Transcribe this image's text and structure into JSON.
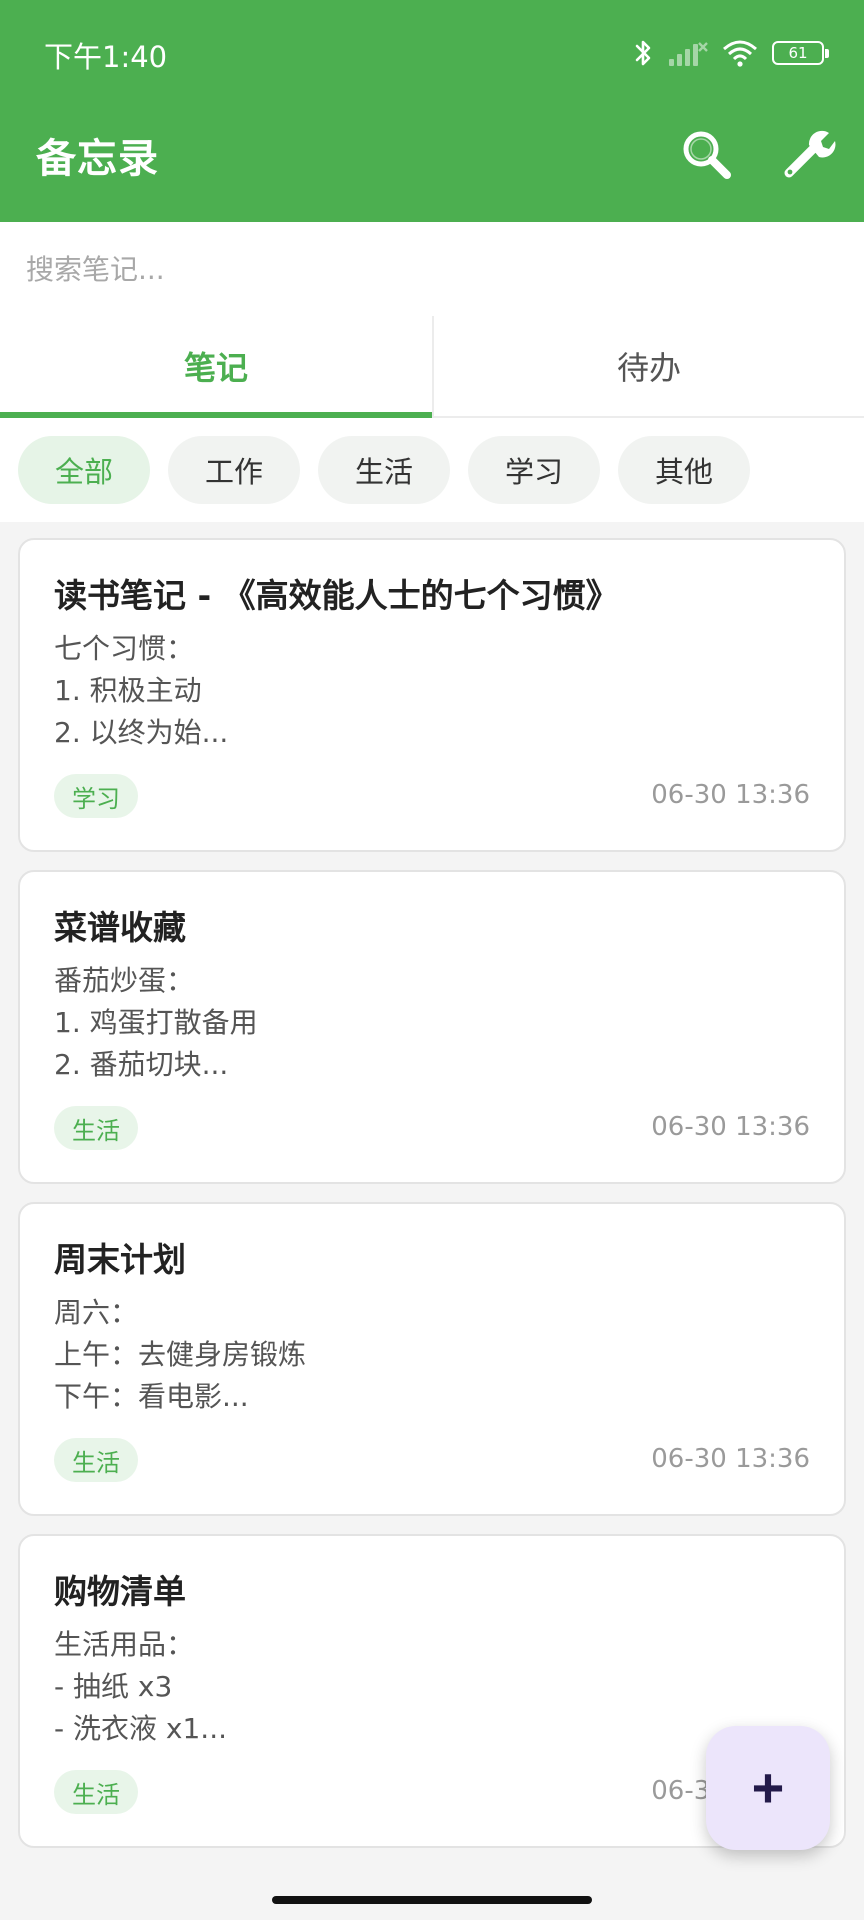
{
  "status_bar": {
    "time": "下午1:40",
    "battery": "61",
    "icons": [
      "bluetooth-icon",
      "cellular-signal-icon",
      "wifi-icon",
      "battery-icon"
    ]
  },
  "header": {
    "title": "备忘录",
    "search_icon": "search-icon",
    "settings_icon": "wrench-icon"
  },
  "search": {
    "placeholder": "搜索笔记...",
    "value": ""
  },
  "tabs": [
    {
      "label": "笔记",
      "active": true
    },
    {
      "label": "待办",
      "active": false
    }
  ],
  "categories": [
    {
      "label": "全部",
      "active": true
    },
    {
      "label": "工作",
      "active": false
    },
    {
      "label": "生活",
      "active": false
    },
    {
      "label": "学习",
      "active": false
    },
    {
      "label": "其他",
      "active": false
    }
  ],
  "notes": [
    {
      "title": "读书笔记 - 《高效能人士的七个习惯》",
      "preview": "七个习惯：\n1. 积极主动\n2. 以终为始...",
      "tag": "学习",
      "time": "06-30 13:36"
    },
    {
      "title": "菜谱收藏",
      "preview": "番茄炒蛋：\n1. 鸡蛋打散备用\n2. 番茄切块...",
      "tag": "生活",
      "time": "06-30 13:36"
    },
    {
      "title": "周末计划",
      "preview": "周六：\n上午：去健身房锻炼\n下午：看电影...",
      "tag": "生活",
      "time": "06-30 13:36"
    },
    {
      "title": "购物清单",
      "preview": "生活用品：\n- 抽纸 x3\n- 洗衣液 x1...",
      "tag": "生活",
      "time": "06-30 13:36"
    }
  ],
  "fab": {
    "label": "+",
    "color": "#ece5fb"
  },
  "colors": {
    "primary": "#4caf50",
    "chip_active_bg": "#e6f4e7"
  }
}
